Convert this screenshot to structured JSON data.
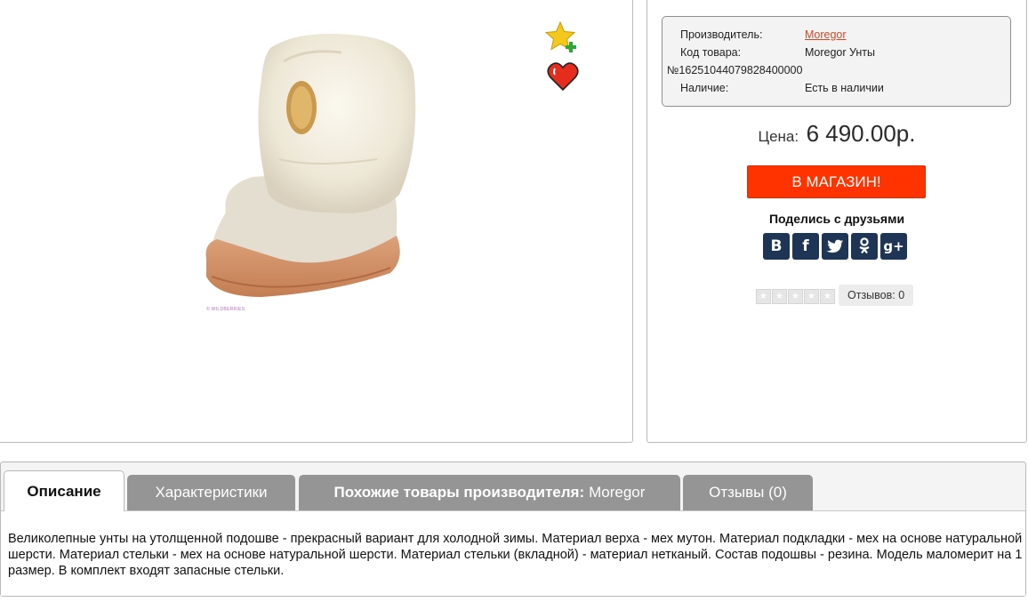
{
  "product": {
    "image_watermark": "© WILDBERRIES",
    "favorite_icon": "star-plus-icon",
    "wishlist_icon": "heart-icon"
  },
  "specs": {
    "manufacturer_label": "Производитель:",
    "manufacturer_value": "Moregor",
    "code_label": "Код товара:",
    "code_value": "Moregor Унты",
    "code_number": "№16251044079828400000",
    "availability_label": "Наличие:",
    "availability_value": "Есть в наличии"
  },
  "price": {
    "label": "Цена:",
    "value": "6 490.00р."
  },
  "buy_button": "В МАГАЗИН!",
  "share": {
    "title": "Поделись с друзьями",
    "networks": [
      {
        "icon": "vk-icon",
        "glyph": "В"
      },
      {
        "icon": "facebook-icon",
        "glyph": "f"
      },
      {
        "icon": "twitter-icon",
        "glyph": ""
      },
      {
        "icon": "odnoklassniki-icon",
        "glyph": ""
      },
      {
        "icon": "google-plus-icon",
        "glyph": "g+"
      }
    ]
  },
  "rating": {
    "stars_filled": 0,
    "stars_total": 5,
    "reviews_label": "Отзывов: 0"
  },
  "tabs": [
    {
      "label": "Описание",
      "active": true
    },
    {
      "label": "Характеристики",
      "active": false
    },
    {
      "bold": "Похожие товары производителя:",
      "label": "Moregor",
      "active": false
    },
    {
      "label": "Отзывы (0)",
      "active": false
    }
  ],
  "description": "Великолепные унты на утолщенной подошве - прекрасный вариант для холодной зимы. Материал верха - мех мутон. Материал подкладки - мех на основе натуральной шерсти. Материал стельки - мех на основе натуральной шерсти. Материал стельки (вкладной) - материал нетканый. Состав подошвы - резина. Модель маломерит на 1 размер. В комплект входят запасные стельки.",
  "colors": {
    "accent_button": "#ff3300",
    "brand_link": "#cc4a2b",
    "social_bg": "#1e3556",
    "tab_inactive": "#959595"
  }
}
